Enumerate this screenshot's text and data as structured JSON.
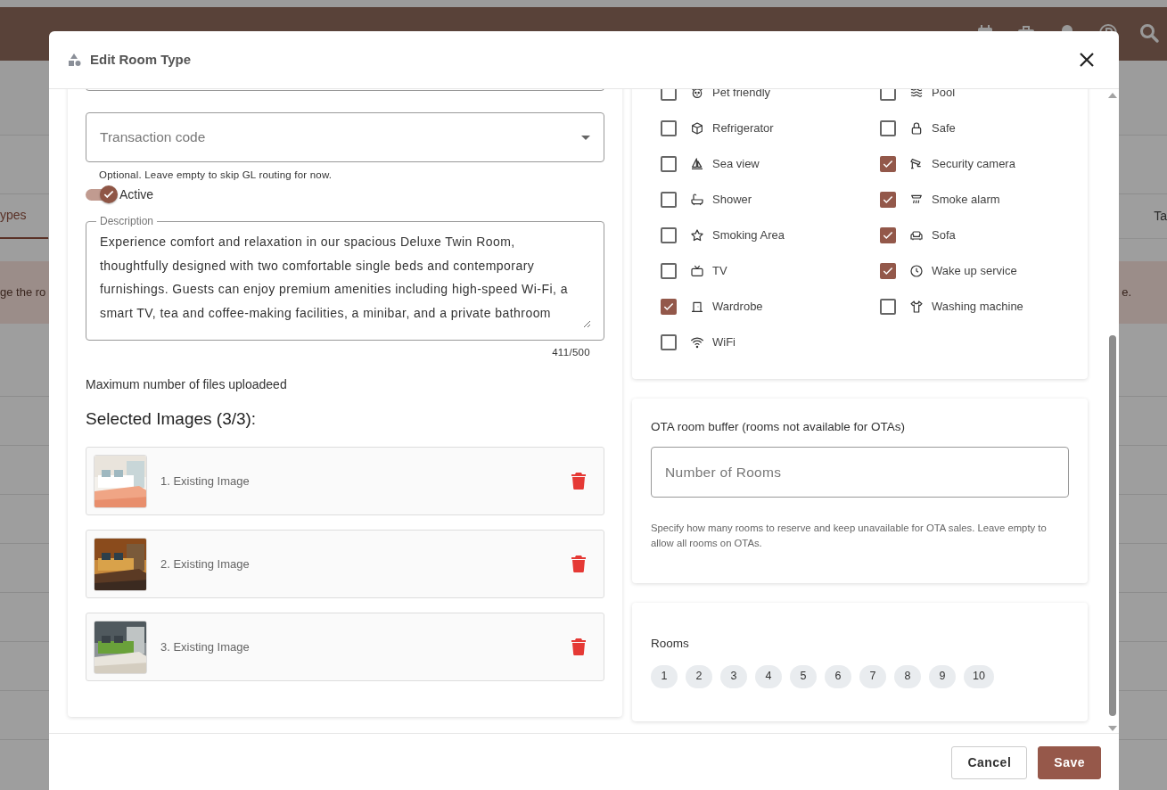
{
  "background": {
    "tabs": [
      {
        "label": "ypes",
        "selected": true
      },
      {
        "label": "Ta",
        "selected": false
      }
    ],
    "banner": {
      "text_left": "ge the ro",
      "text_right": "e."
    }
  },
  "dialog": {
    "title": "Edit Room Type",
    "transaction_code": {
      "placeholder": "Transaction code",
      "hint": "Optional. Leave empty to skip GL routing for now."
    },
    "active": {
      "label": "Active",
      "on": true
    },
    "description": {
      "label": "Description",
      "value": "Experience comfort and relaxation in our spacious Deluxe Twin Room, thoughtfully designed with two comfortable single beds and contemporary furnishings. Guests can enjoy premium amenities including high-speed Wi-Fi, a smart TV, tea and coffee-making facilities, a minibar, and a private bathroom",
      "counter": "411/500"
    },
    "files_note": "Maximum number of files uploadeed",
    "images": {
      "heading": "Selected Images (3/3):",
      "items": [
        {
          "label": "1. Existing Image",
          "kind": "picture"
        },
        {
          "label": "2. Existing Image",
          "kind": "picture"
        },
        {
          "label": "3. Existing Image",
          "kind": "picture"
        }
      ]
    },
    "amenities": [
      {
        "label": "Pet friendly",
        "checked": false
      },
      {
        "label": "Pool",
        "checked": false
      },
      {
        "label": "Refrigerator",
        "checked": false
      },
      {
        "label": "Safe",
        "checked": false
      },
      {
        "label": "Sea view",
        "checked": false
      },
      {
        "label": "Security camera",
        "checked": true
      },
      {
        "label": "Shower",
        "checked": false
      },
      {
        "label": "Smoke alarm",
        "checked": true
      },
      {
        "label": "Smoking Area",
        "checked": false
      },
      {
        "label": "Sofa",
        "checked": true
      },
      {
        "label": "TV",
        "checked": false
      },
      {
        "label": "Wake up service",
        "checked": true
      },
      {
        "label": "Wardrobe",
        "checked": true
      },
      {
        "label": "Washing machine",
        "checked": false
      },
      {
        "label": "WiFi",
        "checked": false
      }
    ],
    "ota": {
      "label": "OTA room buffer (rooms not available for OTAs)",
      "placeholder": "Number of Rooms",
      "hint": "Specify how many rooms to reserve and keep unavailable for OTA sales. Leave empty to allow all rooms on OTAs."
    },
    "rooms": {
      "label": "Rooms",
      "chips": [
        "1",
        "2",
        "3",
        "4",
        "5",
        "6",
        "7",
        "8",
        "9",
        "10"
      ]
    },
    "buttons": [
      {
        "label": "Cancel",
        "kind": "secondary"
      },
      {
        "label": "Save",
        "kind": "primary"
      }
    ]
  }
}
